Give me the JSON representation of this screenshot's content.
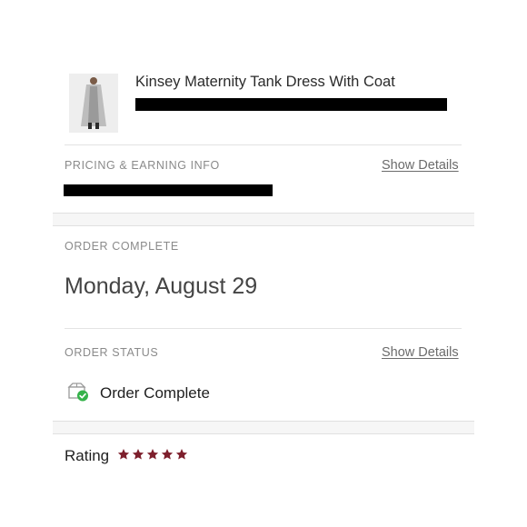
{
  "product": {
    "title": "Kinsey Maternity Tank Dress With Coat",
    "thumbnail_icon": "product-photo-icon"
  },
  "pricing": {
    "label": "PRICING & EARNING INFO",
    "show_details": "Show Details"
  },
  "order_complete": {
    "label": "ORDER COMPLETE",
    "date": "Monday, August 29"
  },
  "order_status": {
    "label": "ORDER STATUS",
    "show_details": "Show Details",
    "status": "Order Complete",
    "icon": "box-check-icon"
  },
  "rating": {
    "label": "Rating",
    "stars": 5,
    "max_stars": 5,
    "star_color": "#7d1f2c"
  },
  "colors": {
    "accent_green": "#35b24a",
    "star": "#7d1f2c"
  }
}
